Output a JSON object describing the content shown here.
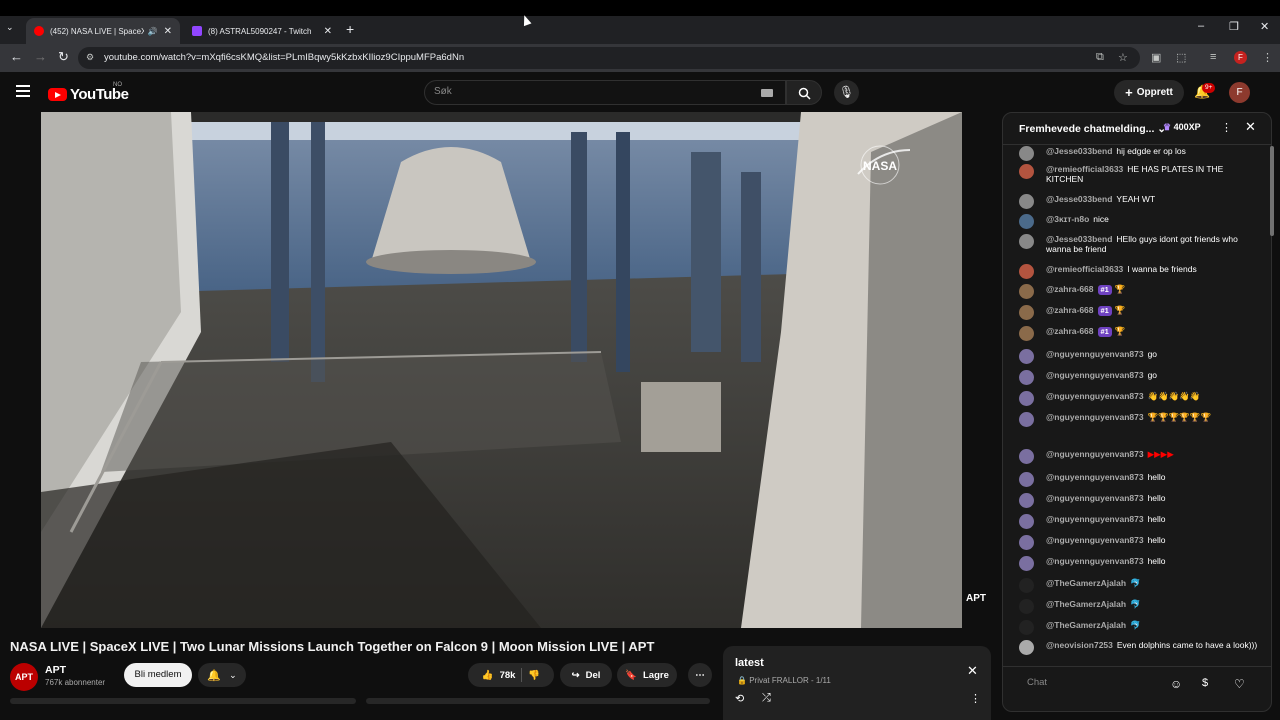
{
  "browser": {
    "tabs": [
      {
        "title": "(452) NASA LIVE | SpaceX LI",
        "favicon_color": "#ff0000",
        "active": true
      },
      {
        "title": "(8) ASTRAL5090247 - Twitch",
        "favicon_color": "#9146ff",
        "active": false
      }
    ],
    "new_tab": "+",
    "url": "youtube.com/watch?v=mXqfi6csKMQ&list=PLmIBqwy5kKzbxKIlioz9CIppuMFPa6dNn",
    "profile_initial": "F"
  },
  "yt_header": {
    "logo_text": "YouTube",
    "country": "NO",
    "search_placeholder": "Søk",
    "create_label": "Opprett",
    "notif_count": "9+",
    "avatar_initial": "F"
  },
  "video": {
    "title": "NASA LIVE | SpaceX LIVE | Two Lunar Missions Launch Together on Falcon 9 | Moon Mission LIVE | APT",
    "watermark_nasa": "NASA",
    "watermark_apt": "APT",
    "channel_avatar": "APT",
    "channel_name": "APT",
    "subscribers": "767k abonnenter",
    "join_label": "Bli medlem",
    "likes": "78k",
    "share_label": "Del",
    "save_label": "Lagre"
  },
  "playlist": {
    "title": "latest",
    "subtitle": "Privat FRALLOR - 1/11"
  },
  "chat": {
    "title": "Fremhevede chatmelding...",
    "xp": "400XP",
    "input_placeholder": "Chat",
    "messages": [
      {
        "author": "@Jesse033bend",
        "text": "hij edgde er op los",
        "av": "#888888"
      },
      {
        "author": "@remieofficial3633",
        "text": "HE HAS PLATES IN THE KITCHEN",
        "av": "#b3543f"
      },
      {
        "author": "@Jesse033bend",
        "text": "YEAH WT",
        "av": "#888888"
      },
      {
        "author": "@3ĸɪᴛ-n8o",
        "text": "nice",
        "av": "#4b6a8a"
      },
      {
        "author": "@Jesse033bend",
        "text": "HEllo guys idont got friends who wanna be friend",
        "av": "#888888"
      },
      {
        "author": "@remieofficial3633",
        "text": "I wanna be friends",
        "av": "#b3543f"
      },
      {
        "author": "@zahra-668",
        "badge": "#1",
        "text": "🏆",
        "av": "#8a6a4a"
      },
      {
        "author": "@zahra-668",
        "badge": "#1",
        "text": "🏆",
        "av": "#8a6a4a"
      },
      {
        "author": "@zahra-668",
        "badge": "#1",
        "text": "🏆",
        "av": "#8a6a4a"
      },
      {
        "author": "@nguyennguyenvan873",
        "text": "go",
        "av": "#7a6fa0"
      },
      {
        "author": "@nguyennguyenvan873",
        "text": "go",
        "av": "#7a6fa0"
      },
      {
        "author": "@nguyennguyenvan873",
        "text": "👋👋👋👋👋",
        "av": "#7a6fa0"
      },
      {
        "author": "@nguyennguyenvan873",
        "text": "🏆🏆🏆🏆🏆🏆",
        "av": "#7a6fa0"
      },
      {
        "author": "@nguyennguyenvan873",
        "text": "▶▶▶▶",
        "av": "#7a6fa0"
      },
      {
        "author": "@nguyennguyenvan873",
        "text": "hello",
        "av": "#7a6fa0"
      },
      {
        "author": "@nguyennguyenvan873",
        "text": "hello",
        "av": "#7a6fa0"
      },
      {
        "author": "@nguyennguyenvan873",
        "text": "hello",
        "av": "#7a6fa0"
      },
      {
        "author": "@nguyennguyenvan873",
        "text": "hello",
        "av": "#7a6fa0"
      },
      {
        "author": "@nguyennguyenvan873",
        "text": "hello",
        "av": "#7a6fa0"
      },
      {
        "author": "@TheGamerzAjalah",
        "text": "🐬",
        "av": "#222222"
      },
      {
        "author": "@TheGamerzAjalah",
        "text": "🐬",
        "av": "#222222"
      },
      {
        "author": "@TheGamerzAjalah",
        "text": "🐬",
        "av": "#222222"
      },
      {
        "author": "@neovision7253",
        "text": "Even dolphins came to have a look)))",
        "av": "#aaaaaa"
      }
    ]
  }
}
